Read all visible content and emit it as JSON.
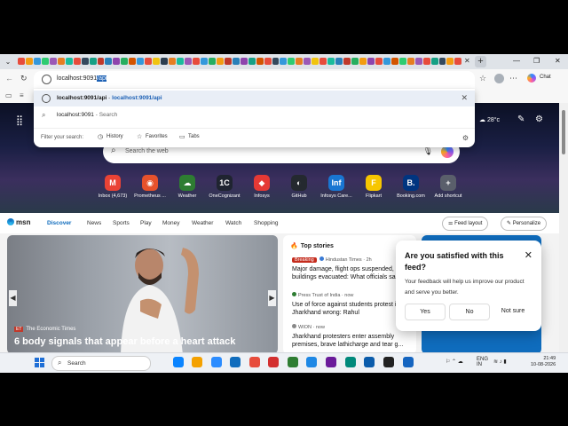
{
  "browser": {
    "address_prefix": "localhost:9091",
    "address_selected": "/api",
    "chat_label": "Chat",
    "tab_icon_colors": [
      "#e74c3c",
      "#f39c12",
      "#3498db",
      "#2ecc71",
      "#9b59b6",
      "#e67e22",
      "#1abc9c",
      "#e74c3c",
      "#34495e",
      "#16a085",
      "#c0392b",
      "#2980b9",
      "#8e44ad",
      "#27ae60",
      "#d35400",
      "#3498db",
      "#e74c3c",
      "#f1c40f",
      "#2c3e50",
      "#e67e22",
      "#1abc9c",
      "#9b59b6",
      "#e74c3c",
      "#3498db",
      "#27ae60",
      "#f39c12",
      "#c0392b",
      "#2980b9",
      "#8e44ad",
      "#16a085",
      "#d35400",
      "#e74c3c",
      "#34495e",
      "#3498db",
      "#2ecc71",
      "#e67e22",
      "#9b59b6",
      "#f1c40f",
      "#e74c3c",
      "#1abc9c",
      "#2980b9",
      "#c0392b",
      "#27ae60",
      "#f39c12",
      "#8e44ad",
      "#e74c3c",
      "#3498db",
      "#d35400",
      "#2ecc71",
      "#e67e22",
      "#9b59b6",
      "#e74c3c",
      "#16a085",
      "#34495e",
      "#f39c12",
      "#e74c3c"
    ]
  },
  "dropdown": {
    "suggestion1_url": "localhost:9091/api",
    "suggestion1_sep": " - ",
    "suggestion1_link": "localhost:9091/api",
    "suggestion2_text": "localhost:9091",
    "suggestion2_sub": " - Search",
    "filter_label": "Filter your search:",
    "chips": [
      "History",
      "Favorites",
      "Tabs"
    ]
  },
  "msn": {
    "weather": "28°c",
    "search_placeholder": "Search the web",
    "tiles": [
      {
        "label": "Inbox (4,673)",
        "letter": "M",
        "color": "#ea4335"
      },
      {
        "label": "Prometheus ...",
        "letter": "◉",
        "color": "#e6522c"
      },
      {
        "label": "Weather",
        "letter": "☁",
        "color": "#2e7d32"
      },
      {
        "label": "OneCognizant",
        "letter": "1C",
        "color": "#1f2430"
      },
      {
        "label": "Infosys",
        "letter": "◆",
        "color": "#e53935"
      },
      {
        "label": "GitHub",
        "letter": "◐",
        "color": "#24292f"
      },
      {
        "label": "Infosys Care...",
        "letter": "Inf",
        "color": "#1976d2"
      },
      {
        "label": "Flipkart",
        "letter": "F",
        "color": "#f7c600"
      },
      {
        "label": "Booking.com",
        "letter": "B.",
        "color": "#003580"
      },
      {
        "label": "Add shortcut",
        "letter": "+",
        "color": "#5a5f6b"
      }
    ],
    "logo": "msn",
    "nav": [
      "Discover",
      "News",
      "Sports",
      "Play",
      "Money",
      "Weather",
      "Watch",
      "Shopping"
    ],
    "feed_layout": "Feed layout",
    "personalize": "Personalize"
  },
  "bigcard": {
    "source_badge": "ET",
    "source": "The Economic Times",
    "headline": "6 body signals that appear before a heart attack"
  },
  "topstories": {
    "title": "Top stories",
    "stories": [
      {
        "badge": "Breaking",
        "source": "Hindustan Times · 2h",
        "headline": "Major damage, flight ops suspended, buildings evacuated: What officials sa..."
      },
      {
        "badge": "",
        "source": "Press Trust of India · now",
        "headline": "Use of force against students protest in Jharkhand wrong: Rahul"
      },
      {
        "badge": "",
        "source": "WION · now",
        "headline": "Jharkhand protesters enter assembly premises, brave lathicharge and tear g..."
      }
    ]
  },
  "feedback": {
    "question": "Are you satisfied with this feed?",
    "description": "Your feedback will help us improve our product and serve you better.",
    "yes": "Yes",
    "no": "No",
    "not_sure": "Not sure"
  },
  "taskbar": {
    "search": "Search",
    "lang1": "ENG",
    "lang2": "IN",
    "time": "21:49",
    "date": "10-08-2026",
    "app_colors": [
      "#0a84ff",
      "#f4a100",
      "#2b8cff",
      "#0f6cbd",
      "#e74c3c",
      "#d32f2f",
      "#2e7d32",
      "#1e88e5",
      "#6a1b9a",
      "#00897b",
      "#0b5cab",
      "#222222",
      "#1565c0"
    ]
  }
}
